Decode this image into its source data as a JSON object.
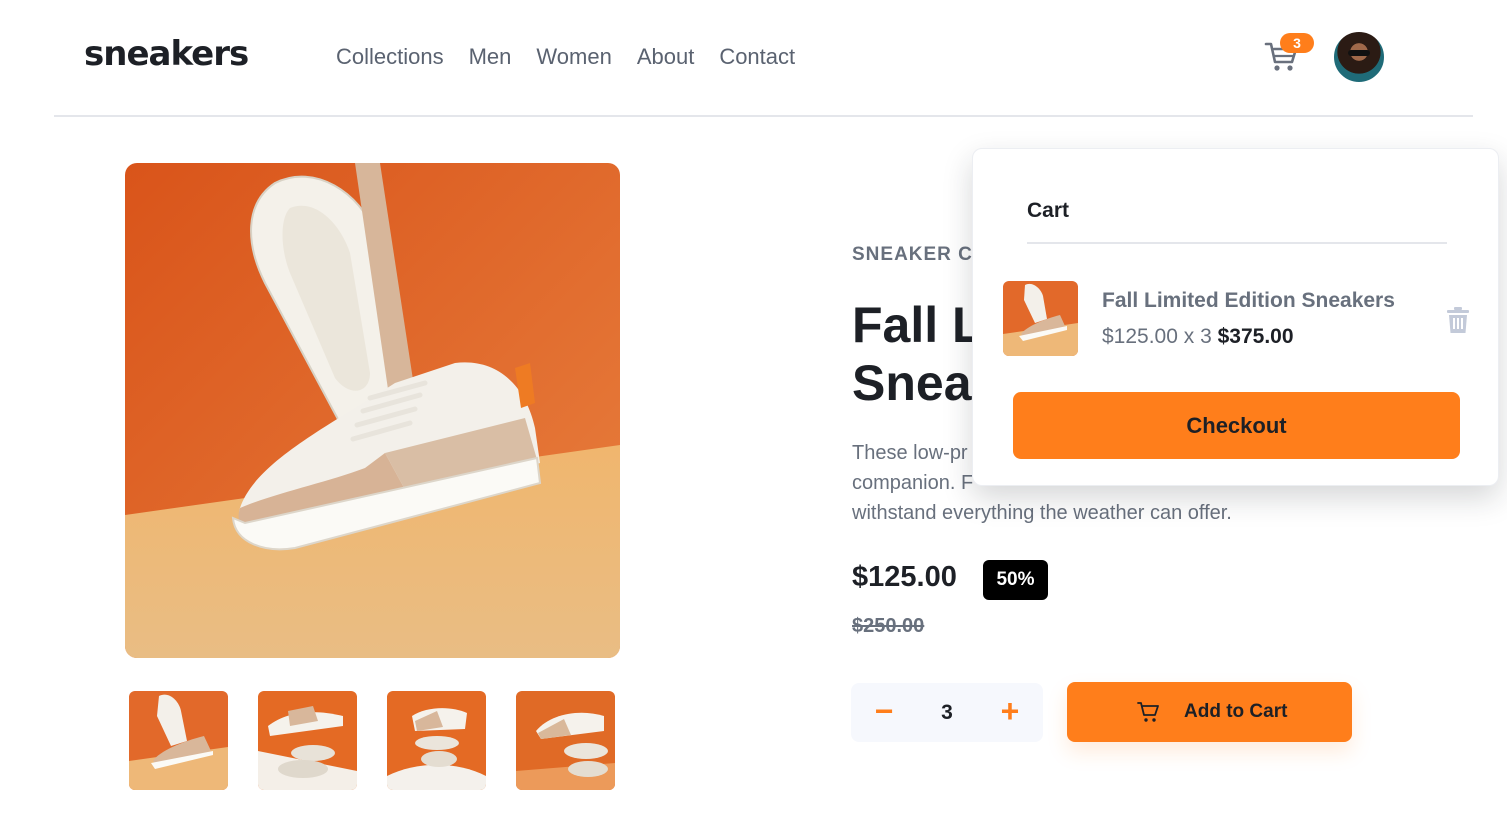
{
  "brand": {
    "logo": "sneakers"
  },
  "nav": {
    "items": [
      {
        "label": "Collections"
      },
      {
        "label": "Men"
      },
      {
        "label": "Women"
      },
      {
        "label": "About"
      },
      {
        "label": "Contact"
      }
    ]
  },
  "header": {
    "cart_count": "3",
    "cart_icon": "cart-icon",
    "avatar_icon": "user-avatar"
  },
  "gallery": {
    "main_image": "product-photo-1",
    "thumbnails": [
      "product-thumb-1",
      "product-thumb-2",
      "product-thumb-3",
      "product-thumb-4"
    ]
  },
  "product": {
    "company": "SNEAKER CO",
    "title_line1": "Fall L",
    "title_line2": "Snea",
    "description_line1": "These low-pr",
    "description_line2": "companion. F",
    "description_line3": "withstand everything the weather can offer.",
    "price": "$125.00",
    "discount": "50%",
    "old_price": "$250.00"
  },
  "purchase": {
    "minus_label": "−",
    "quantity": "3",
    "plus_label": "+",
    "add_to_cart_label": "Add to Cart"
  },
  "cart": {
    "title": "Cart",
    "item": {
      "name": "Fall Limited Edition Sneakers",
      "unit_price_x_qty": "$125.00 x 3",
      "total": "$375.00"
    },
    "checkout_label": "Checkout"
  },
  "colors": {
    "accent": "#ff7e1b",
    "dark": "#1d2026",
    "muted": "#68707d",
    "light_bg": "#f6f8fd"
  }
}
